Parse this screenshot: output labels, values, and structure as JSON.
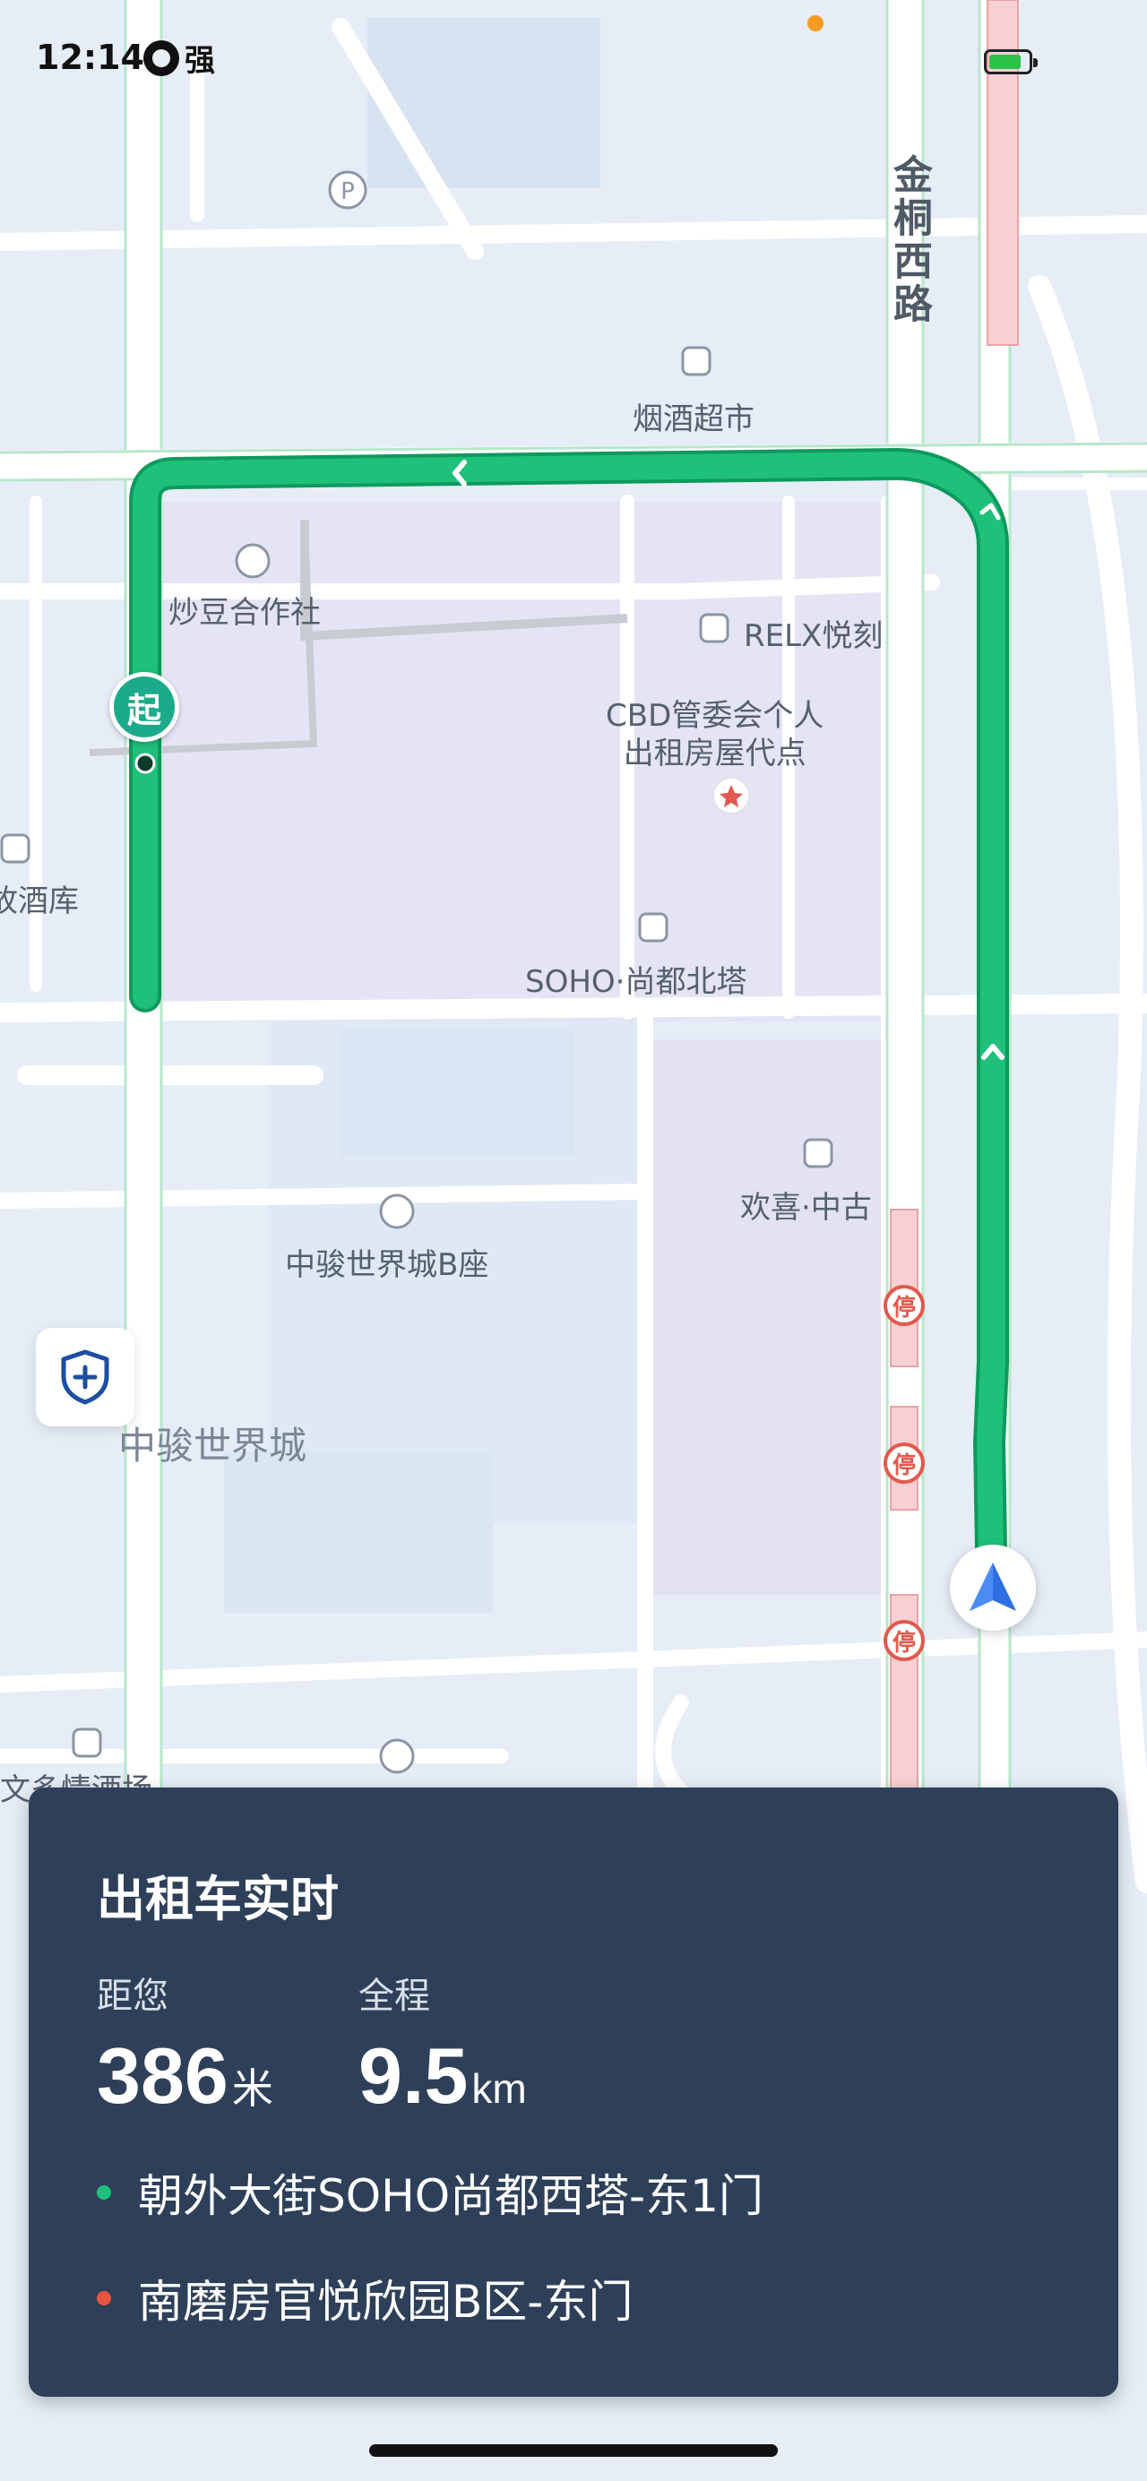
{
  "status_bar": {
    "time": "12:14",
    "network": "强"
  },
  "map": {
    "road_label": "金桐西路",
    "pois": [
      {
        "id": "tobacco",
        "label": "烟酒超市"
      },
      {
        "id": "chaodou",
        "label": "炒豆合作社"
      },
      {
        "id": "relx",
        "label": "RELX悦刻"
      },
      {
        "id": "cbd",
        "label": "CBD管委会个人\n出租房屋代点"
      },
      {
        "id": "winecellar",
        "label": "故酒库"
      },
      {
        "id": "soho",
        "label": "SOHO·尚都北塔"
      },
      {
        "id": "huanxi",
        "label": "欢喜·中古"
      },
      {
        "id": "zhongjun_b",
        "label": "中骏世界城B座"
      },
      {
        "id": "wenduo",
        "label": "文多情酒场"
      }
    ],
    "area_label": "中骏世界城",
    "start_label": "起",
    "stop_sign_label": "停",
    "parking_label": "P",
    "route_color": "#1fc07a",
    "route_outline": "#0e9a5d"
  },
  "card": {
    "title": "出租车实时",
    "distance_label": "距您",
    "distance_value": "386",
    "distance_unit": "米",
    "total_label": "全程",
    "total_value": "9.5",
    "total_unit": "km",
    "origin": "朝外大街SOHO尚都西塔-东1门",
    "destination": "南磨房官悦欣园B区-东门",
    "origin_color": "#1fc07a",
    "destination_color": "#e8553f"
  }
}
